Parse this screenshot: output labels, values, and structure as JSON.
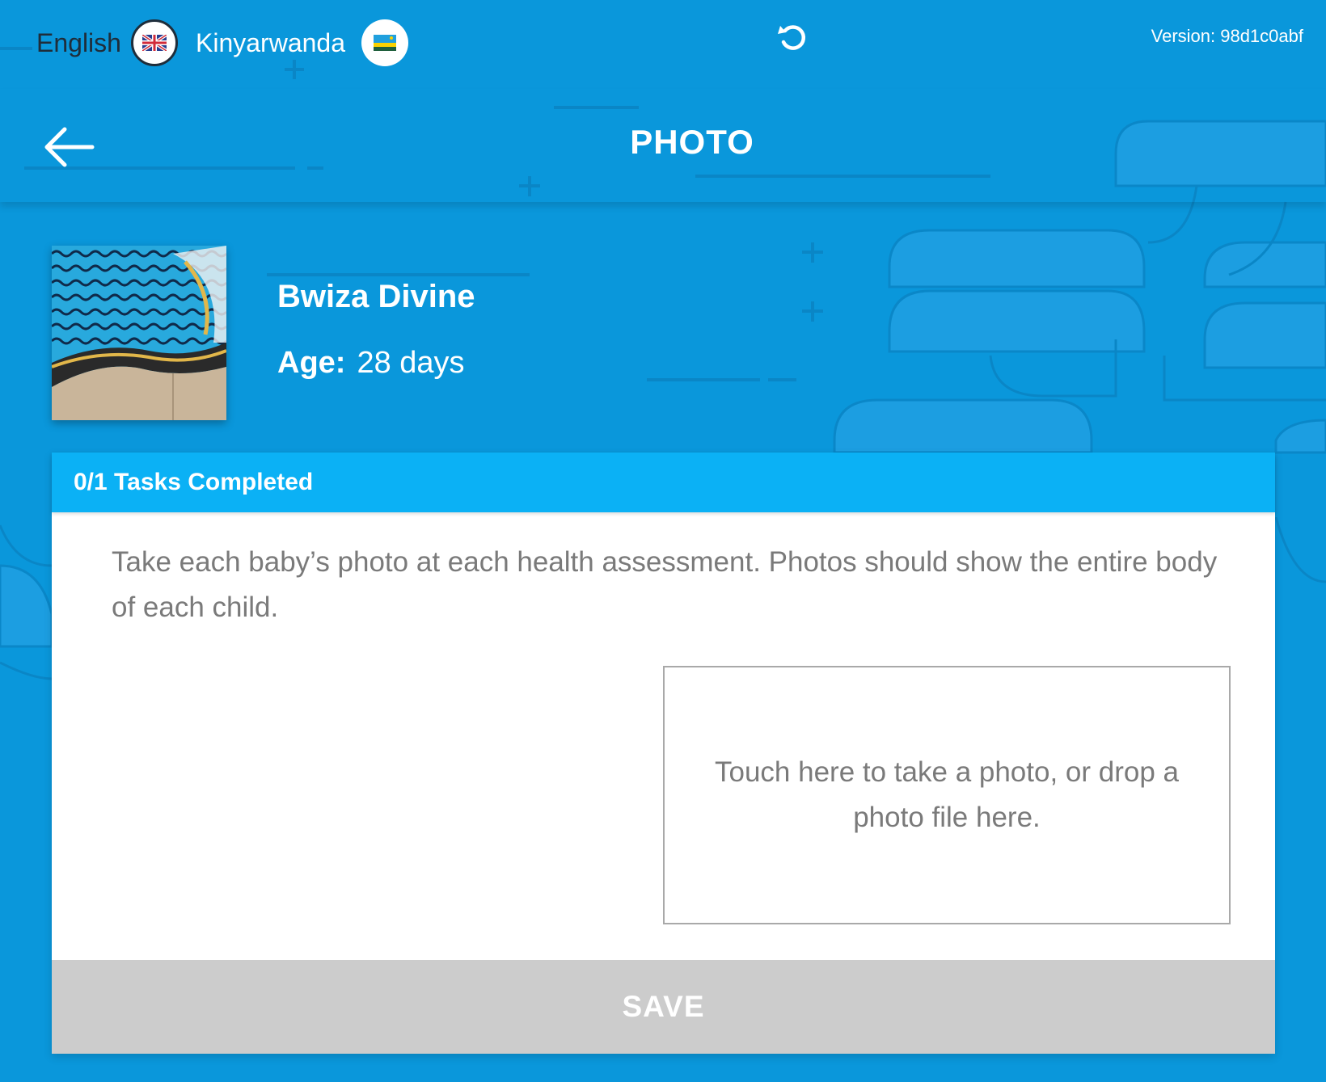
{
  "languages": [
    {
      "label": "English",
      "flag": "uk-flag-icon",
      "active": true
    },
    {
      "label": "Kinyarwanda",
      "flag": "rwanda-flag-icon",
      "active": false
    }
  ],
  "version_text": "Version: 98d1c0abf",
  "header": {
    "title": "PHOTO"
  },
  "patient": {
    "name": "Bwiza Divine",
    "age_label": "Age:",
    "age_value": "28 days"
  },
  "tasks": {
    "completed_text": "0/1 Tasks Completed"
  },
  "instructions": "Take each baby’s photo at each health assessment. Photos should show the entire body of each child.",
  "dropzone": {
    "text": "Touch here to take a photo, or drop a photo file here."
  },
  "save_label": "SAVE",
  "colors": {
    "background": "#0a97db",
    "tasks_bar": "#0bb1f5",
    "save_disabled": "#cccccc",
    "body_text": "#7a7a7a"
  }
}
